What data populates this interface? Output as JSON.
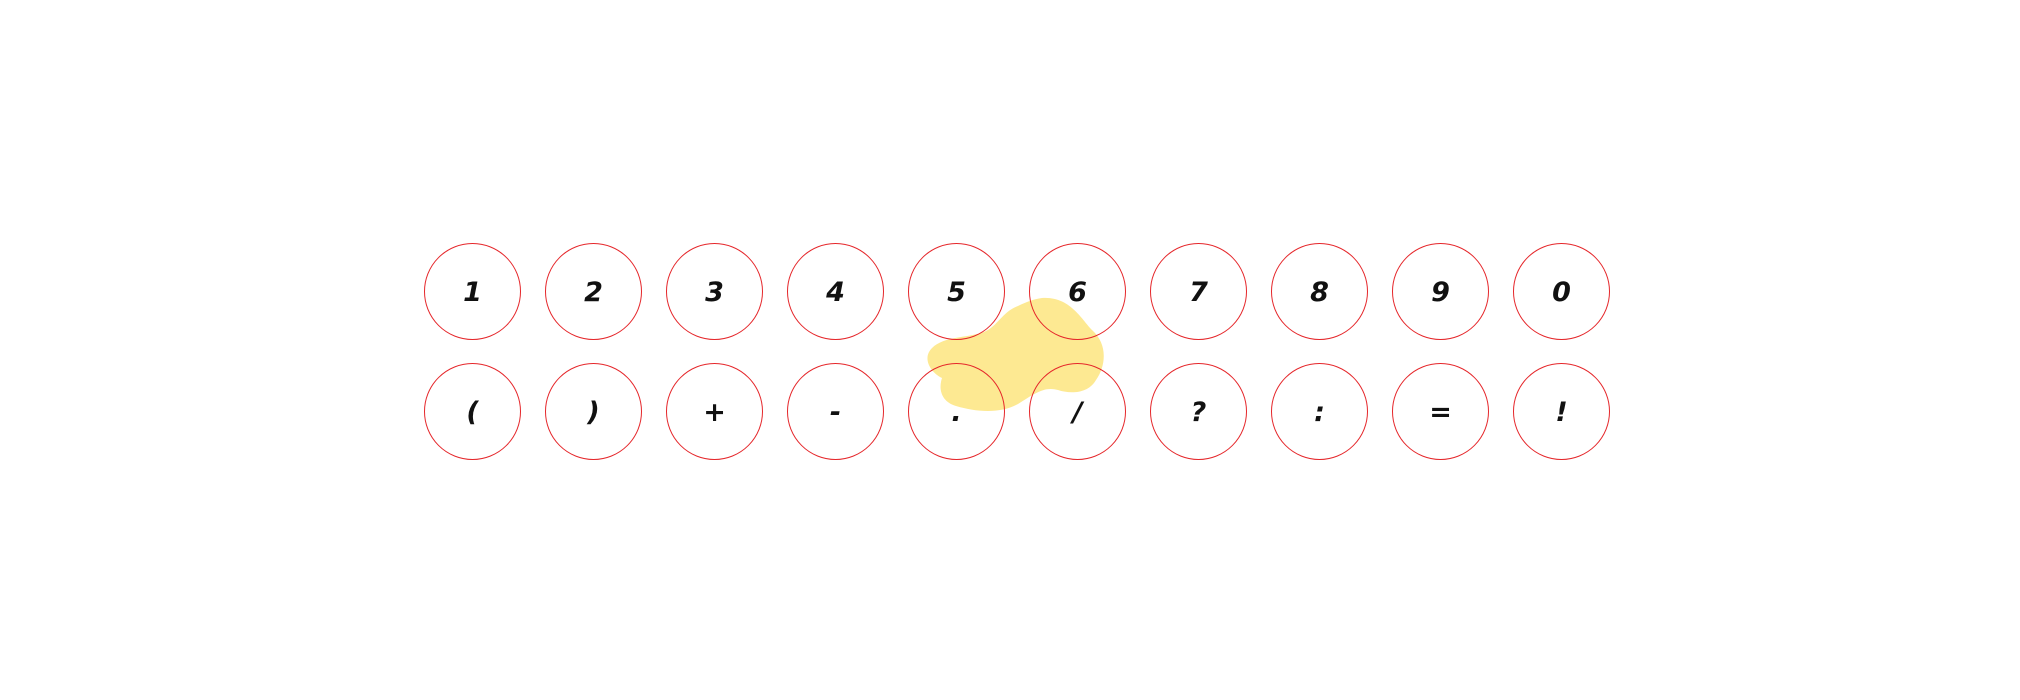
{
  "keypad": {
    "rows": [
      [
        "1",
        "2",
        "3",
        "4",
        "5",
        "6",
        "7",
        "8",
        "9",
        "0"
      ],
      [
        "(",
        ")",
        "+",
        "-",
        ".",
        "/",
        "?",
        ":",
        "=",
        "!"
      ]
    ]
  },
  "colors": {
    "key_border": "#e5262a",
    "key_text": "#111111",
    "highlight_blob": "#fde992",
    "background": "#ffffff"
  }
}
